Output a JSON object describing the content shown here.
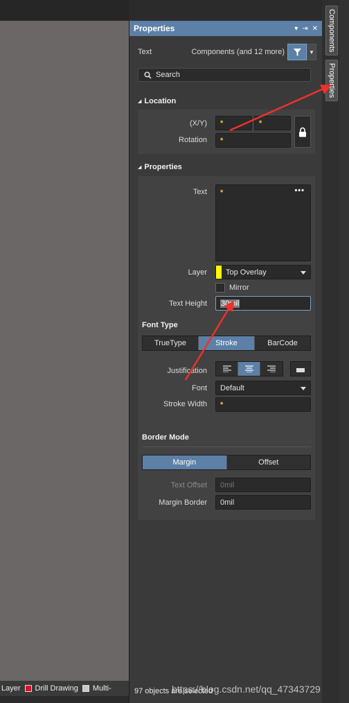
{
  "panel": {
    "title": "Properties",
    "header_controls": [
      "▾",
      "⇥",
      "✕"
    ],
    "object_type": "Text",
    "selection_filter": "Components (and 12 more)",
    "search_placeholder": "Search"
  },
  "location": {
    "title": "Location",
    "xy_label": "(X/Y)",
    "x_value": "*",
    "y_value": "*",
    "rotation_label": "Rotation",
    "rotation_value": "*"
  },
  "properties": {
    "title": "Properties",
    "text_label": "Text",
    "text_value": "*",
    "more_label": "•••",
    "layer_label": "Layer",
    "layer_value": "Top Overlay",
    "layer_color": "#ffff00",
    "mirror_label": "Mirror",
    "text_height_label": "Text Height",
    "text_height_value": "30mil"
  },
  "font_type": {
    "title": "Font Type",
    "options": [
      "TrueType",
      "Stroke",
      "BarCode"
    ],
    "selected": "Stroke",
    "justification_label": "Justification",
    "font_label": "Font",
    "font_value": "Default",
    "stroke_width_label": "Stroke Width",
    "stroke_width_value": "*"
  },
  "border_mode": {
    "title": "Border Mode",
    "options": [
      "Margin",
      "Offset"
    ],
    "selected": "Margin",
    "text_offset_label": "Text Offset",
    "text_offset_value": "0mil",
    "margin_border_label": "Margin Border",
    "margin_border_value": "0mil"
  },
  "dock_tabs": [
    "Components",
    "Properties"
  ],
  "layer_bar": {
    "items": [
      {
        "label": "Layer",
        "color": ""
      },
      {
        "label": "Drill Drawing",
        "color": "#e0102a"
      },
      {
        "label": "Multi-",
        "color": "#c8c8c8"
      }
    ]
  },
  "status_text": "97 objects are selected",
  "watermark": "https://blog.csdn.net/qq_47343729",
  "colors": {
    "accent": "#5c80a6",
    "panel_bg": "#3a3a3a",
    "canvas_bg": "#6a6766",
    "annotation_arrow": "#f0302a"
  }
}
